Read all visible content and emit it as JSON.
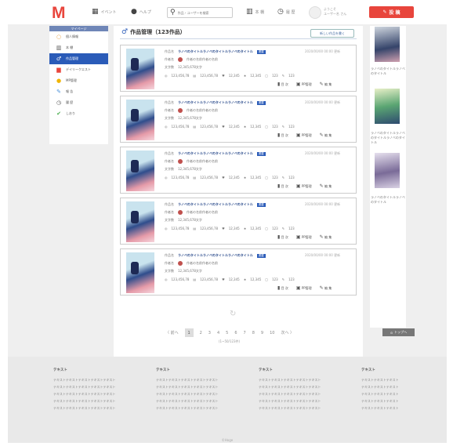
{
  "header": {
    "logo": "M",
    "nav": [
      {
        "icon": "event-icon",
        "glyph": "▦",
        "label": "イベント"
      },
      {
        "icon": "help-icon",
        "glyph": "●",
        "label": "ヘルプ"
      }
    ],
    "search": {
      "placeholder": "作品・ユーザーを検索"
    },
    "nav2": [
      {
        "icon": "bookshelf-icon",
        "glyph": "▥",
        "label": "本 棚"
      },
      {
        "icon": "history-icon",
        "glyph": "◷",
        "label": "履 歴"
      }
    ],
    "welcome_line1": "ようこそ",
    "welcome_line2": "ユーザー名 さん",
    "post_label": "投 稿"
  },
  "sidebar": {
    "heading": "マイページ",
    "items": [
      {
        "label": "個人情報",
        "glyph": "○",
        "color": "#e8a24a"
      },
      {
        "label": "本 棚",
        "glyph": "▥",
        "color": "#555"
      },
      {
        "label": "作品管理",
        "glyph": "♂",
        "color": "#fff"
      },
      {
        "label": "デイリークエスト",
        "glyph": "▆",
        "color": "#e8453c"
      },
      {
        "label": "MP管理",
        "glyph": "●",
        "color": "#f0b400"
      },
      {
        "label": "報 告",
        "glyph": "✎",
        "color": "#4a90d9"
      },
      {
        "label": "履 歴",
        "glyph": "◷",
        "color": "#555"
      },
      {
        "label": "しおり",
        "glyph": "✔",
        "color": "#4caf50"
      }
    ]
  },
  "main": {
    "title": "作品管理（123作品）",
    "new_button": "新しい作品を書く",
    "works": [
      {
        "label_title": "作品名",
        "title": "ラノベのタイトルラノベのタイトルラノベのタイトル",
        "badge": "連載",
        "date": "2020/00/00 00:00 更新",
        "label_author": "作者名",
        "author": "作者の名前作者の名前",
        "label_chars": "文字数",
        "chars": "12,345,678文字",
        "views": "123,456,78",
        "reads": "123,456,78",
        "likes": "12,345",
        "bookmarks": "12,345",
        "comments": "123",
        "reviews": "123"
      },
      {
        "label_title": "作品名",
        "title": "ラノベのタイトルラノベのタイトルラノベのタイトル",
        "badge": "連載",
        "date": "2020/00/00 00:00 更新",
        "label_author": "作者名",
        "author": "作者の名前作者の名前",
        "label_chars": "文字数",
        "chars": "12,345,678文字",
        "views": "123,456,78",
        "reads": "123,456,78",
        "likes": "12,345",
        "bookmarks": "12,345",
        "comments": "123",
        "reviews": "123"
      },
      {
        "label_title": "作品名",
        "title": "ラノベのタイトルラノベのタイトルラノベのタイトル",
        "badge": "連載",
        "date": "2020/00/00 00:00 更新",
        "label_author": "作者名",
        "author": "作者の名前作者の名前",
        "label_chars": "文字数",
        "chars": "12,345,678文字",
        "views": "123,456,78",
        "reads": "123,456,78",
        "likes": "12,345",
        "bookmarks": "12,345",
        "comments": "123",
        "reviews": "123"
      },
      {
        "label_title": "作品名",
        "title": "ラノベのタイトルラノベのタイトルラノベのタイトル",
        "badge": "連載",
        "date": "2020/00/00 00:00 更新",
        "label_author": "作者名",
        "author": "作者の名前作者の名前",
        "label_chars": "文字数",
        "chars": "12,345,678文字",
        "views": "123,456,78",
        "reads": "123,456,78",
        "likes": "12,345",
        "bookmarks": "12,345",
        "comments": "123",
        "reviews": "123"
      },
      {
        "label_title": "作品名",
        "title": "ラノベのタイトルラノベのタイトルラノベのタイトル",
        "badge": "連載",
        "date": "2020/00/00 00:00 更新",
        "label_author": "作者名",
        "author": "作者の名前作者の名前",
        "label_chars": "文字数",
        "chars": "12,345,678文字",
        "views": "123,456,78",
        "reads": "123,456,78",
        "likes": "12,345",
        "bookmarks": "12,345",
        "comments": "123",
        "reviews": "123"
      }
    ],
    "actions": [
      "目 次",
      "PP管理",
      "編 集"
    ],
    "pagination": {
      "prev": "〈 前へ",
      "pages": [
        "1",
        "2",
        "3",
        "4",
        "5",
        "6",
        "7",
        "8",
        "9",
        "10"
      ],
      "current": "1",
      "next": "次へ 〉",
      "total": "(1~50/123件)"
    }
  },
  "right": {
    "books": [
      {
        "caption": "ラノベのタイトルラノベのタイトル"
      },
      {
        "caption": "ラノベのタイトルラノベのタイトルラノベのタイトル"
      },
      {
        "caption": "ラノベのタイトルラノベのタイトル"
      }
    ],
    "to_top": "トップへ"
  },
  "footer": {
    "columns": [
      {
        "heading": "テキスト",
        "lines": [
          "テキストテキストテキストテキストテキスト",
          "テキストテキストテキストテキストテキスト",
          "テキストテキストテキストテキストテキスト",
          "テキストテキストテキストテキストテキスト",
          "テキストテキストテキストテキストテキスト"
        ]
      },
      {
        "heading": "テキスト",
        "lines": [
          "テキストテキストテキストテキストテキスト",
          "テキストテキストテキストテキストテキスト",
          "テキストテキストテキストテキストテキスト",
          "テキストテキストテキストテキストテキスト",
          "テキストテキストテキストテキストテキスト"
        ]
      },
      {
        "heading": "テキスト",
        "lines": [
          "テキストテキストテキストテキストテキスト",
          "テキストテキストテキストテキストテキスト",
          "テキストテキストテキストテキストテキスト",
          "テキストテキストテキストテキストテキスト",
          "テキストテキストテキストテキストテキスト"
        ]
      },
      {
        "heading": "テキスト",
        "lines": [
          "テキストテキストテキスト",
          "テキストテキストテキスト",
          "テキストテキストテキスト",
          "テキストテキストテキスト",
          "テキストテキストテキスト"
        ]
      }
    ],
    "copyright": "©Hoge"
  }
}
